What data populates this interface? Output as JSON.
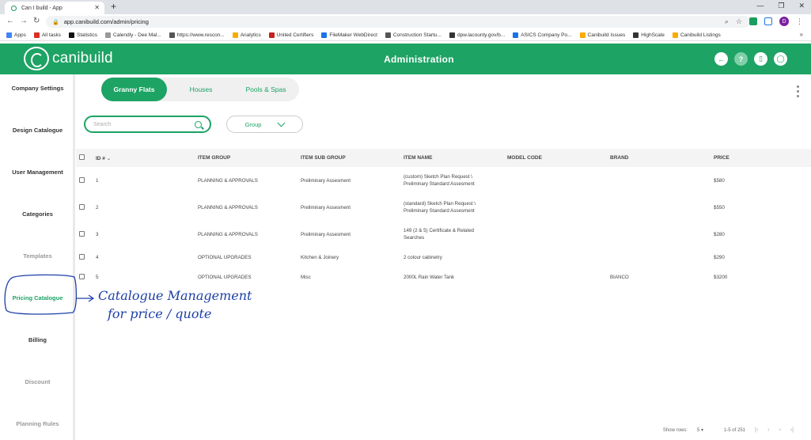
{
  "browser": {
    "tab_title": "Can I build - App",
    "url": "app.canibuild.com/admin/pricing",
    "profile_initial": "D",
    "bookmarks": [
      "Apps",
      "All tasks",
      "Statistics",
      "Calendly - Dee Mal...",
      "https://www.rescon...",
      "Analytics",
      "United Certifiers",
      "FileMaker WebDirect",
      "Construction Startu...",
      "dpw.lacounty.gov/b...",
      "ASICS Company Po...",
      "Canibuild Issues",
      "HighScale",
      "Canibuild Listings"
    ]
  },
  "header": {
    "logo_text": "canibuild",
    "title": "Administration",
    "brand_color": "#1da364"
  },
  "sidebar": {
    "items": [
      {
        "label": "Company Settings",
        "state": "normal"
      },
      {
        "label": "Design Catalogue",
        "state": "normal"
      },
      {
        "label": "User Management",
        "state": "normal"
      },
      {
        "label": "Categories",
        "state": "normal"
      },
      {
        "label": "Templates",
        "state": "muted"
      },
      {
        "label": "Pricing Catalogue",
        "state": "active"
      },
      {
        "label": "Billing",
        "state": "normal"
      },
      {
        "label": "Discount",
        "state": "muted"
      },
      {
        "label": "Planning Rules",
        "state": "muted"
      }
    ]
  },
  "tabs": [
    "Granny Flats",
    "Houses",
    "Pools & Spas"
  ],
  "filters": {
    "search_placeholder": "Search",
    "group_label": "Group"
  },
  "table": {
    "columns": [
      "ID #",
      "ITEM GROUP",
      "ITEM SUB GROUP",
      "ITEM NAME",
      "MODEL CODE",
      "BRAND",
      "PRICE"
    ],
    "rows": [
      {
        "id": "1",
        "group": "PLANNING & APPROVALS",
        "subgroup": "Preliminary Assesment",
        "name1": "(custom) Sketch Plan Request \\",
        "name2": "Preliminary Standard Assesment",
        "model": "",
        "brand": "",
        "price": "$580"
      },
      {
        "id": "2",
        "group": "PLANNING & APPROVALS",
        "subgroup": "Preliminary Assesment",
        "name1": "(standard) Sketch Plan Request \\",
        "name2": "Preliminary Standard Assesment",
        "model": "",
        "brand": "",
        "price": "$550"
      },
      {
        "id": "3",
        "group": "PLANNING & APPROVALS",
        "subgroup": "Preliminary Assesment",
        "name1": "149 (2 & 5) Certificate & Related",
        "name2": "Searches",
        "model": "",
        "brand": "",
        "price": "$280"
      },
      {
        "id": "4",
        "group": "OPTIONAL UPGRADES",
        "subgroup": "Kitchen & Joinery",
        "name1": "2 colour cabinetry",
        "name2": "",
        "model": "",
        "brand": "",
        "price": "$290"
      },
      {
        "id": "5",
        "group": "OPTIONAL UPGRADES",
        "subgroup": "Misc",
        "name1": "2000L Rain Water Tank",
        "name2": "",
        "model": "",
        "brand": "BIANCO",
        "price": "$3200"
      }
    ]
  },
  "pagination": {
    "show_rows_label": "Show rows:",
    "rows_value": "5",
    "range": "1-5 of 251"
  },
  "annotation": {
    "line1": "Catalogue Management",
    "line2": "for price / quote",
    "color": "#1c3fa8"
  }
}
